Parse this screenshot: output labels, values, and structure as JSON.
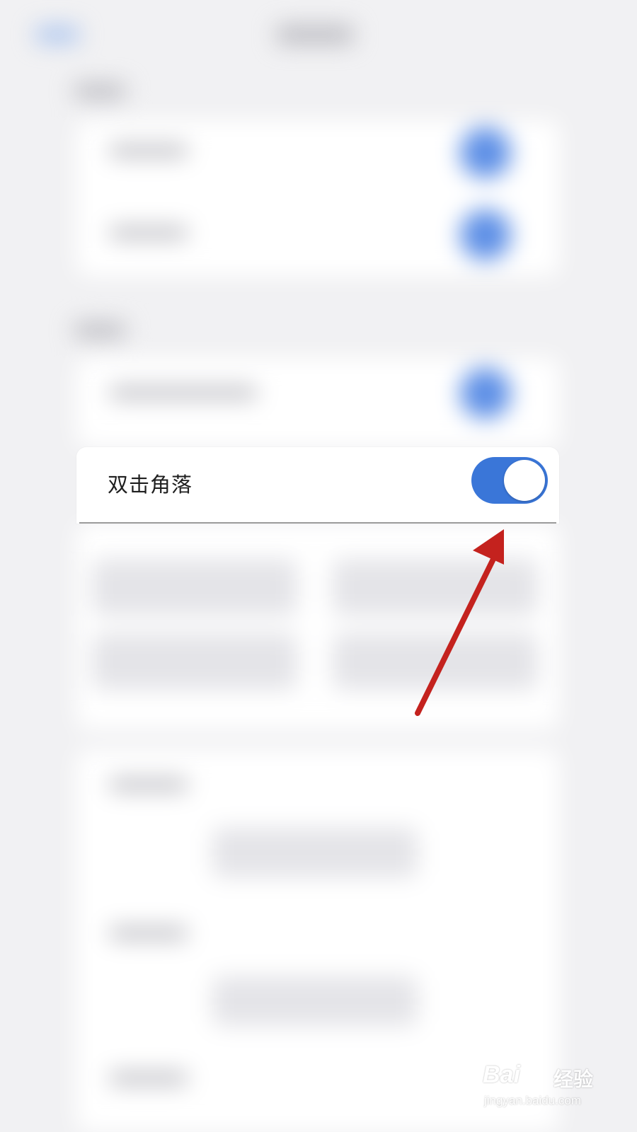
{
  "setting": {
    "label": "双击角落",
    "toggle_on": true
  },
  "colors": {
    "toggle_on": "#3a76d8",
    "arrow": "#c4221e",
    "background": "#f1f1f3"
  },
  "icons": {
    "arrow": "arrow-annotation-icon",
    "watermark": "baidu-jingyan-logo"
  },
  "watermark": {
    "logo": "Bai",
    "sub": "经验",
    "url": "jingyan.baidu.com"
  }
}
